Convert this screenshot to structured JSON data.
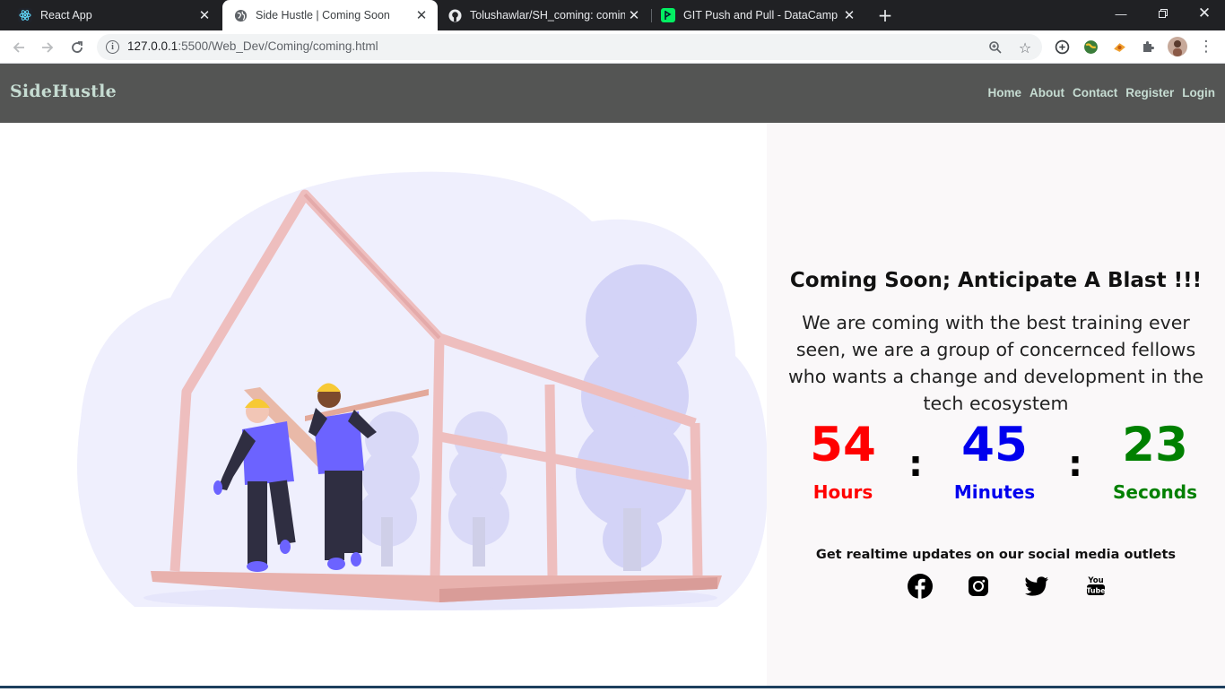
{
  "browser": {
    "tabs": [
      {
        "title": "React App",
        "favicon": "react-icon"
      },
      {
        "title": "Side Hustle | Coming Soon",
        "favicon": "globe-icon",
        "active": true
      },
      {
        "title": "Tolushawlar/SH_coming: coming",
        "favicon": "github-icon"
      },
      {
        "title": "GIT Push and Pull - DataCamp",
        "favicon": "datacamp-icon"
      }
    ],
    "url_host": "127.0.0.1",
    "url_rest": ":5500/Web_Dev/Coming/coming.html"
  },
  "site": {
    "brand": "SideHustle",
    "nav": [
      "Home",
      "About",
      "Contact",
      "Register",
      "Login"
    ]
  },
  "hero": {
    "headline": "Coming Soon; Anticipate A Blast !!!",
    "description": "We are coming with the best training ever seen, we are a group of concernced fellows who wants a change and development in the tech ecosystem"
  },
  "countdown": {
    "hours": "54",
    "hours_label": "Hours",
    "minutes": "45",
    "minutes_label": "Minutes",
    "seconds": "23",
    "seconds_label": "Seconds",
    "colors": {
      "hours": "#ff0000",
      "minutes": "#0000ee",
      "seconds": "#008000"
    }
  },
  "social": {
    "text": "Get realtime updates on our social media outlets",
    "icons": [
      "facebook-icon",
      "instagram-icon",
      "twitter-icon",
      "youtube-icon"
    ]
  }
}
